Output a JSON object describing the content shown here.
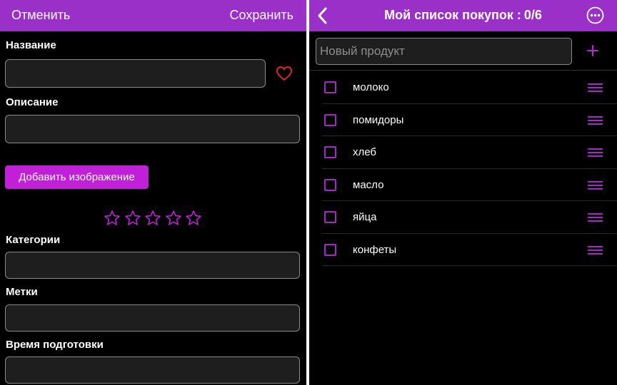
{
  "left": {
    "header": {
      "cancel_label": "Отменить",
      "save_label": "Сохранить"
    },
    "fields": {
      "name_label": "Название",
      "description_label": "Описание",
      "categories_label": "Категории",
      "tags_label": "Метки",
      "prep_time_label": "Время подготовки"
    },
    "add_image_label": "Добавить изображение",
    "rating": {
      "value": 0,
      "max": 5
    }
  },
  "right": {
    "header": {
      "title": "Мой список покупок :",
      "count": "0/6"
    },
    "new_item_placeholder": "Новый продукт",
    "items": [
      {
        "label": "молоко",
        "checked": false
      },
      {
        "label": "помидоры",
        "checked": false
      },
      {
        "label": "хлеб",
        "checked": false
      },
      {
        "label": "масло",
        "checked": false
      },
      {
        "label": "яйца",
        "checked": false
      },
      {
        "label": "конфеты",
        "checked": false
      }
    ]
  },
  "colors": {
    "header_bg": "#9b30c9",
    "accent": "#c21fd9",
    "checkbox": "#a728c6",
    "heart": "#e0262a",
    "background": "#000000"
  },
  "icons": {
    "favorite": "heart-icon",
    "rating_star": "star-outline-icon",
    "back": "chevron-left-icon",
    "more": "ellipsis-circle-icon",
    "add": "plus-icon",
    "reorder": "drag-handle-icon"
  }
}
